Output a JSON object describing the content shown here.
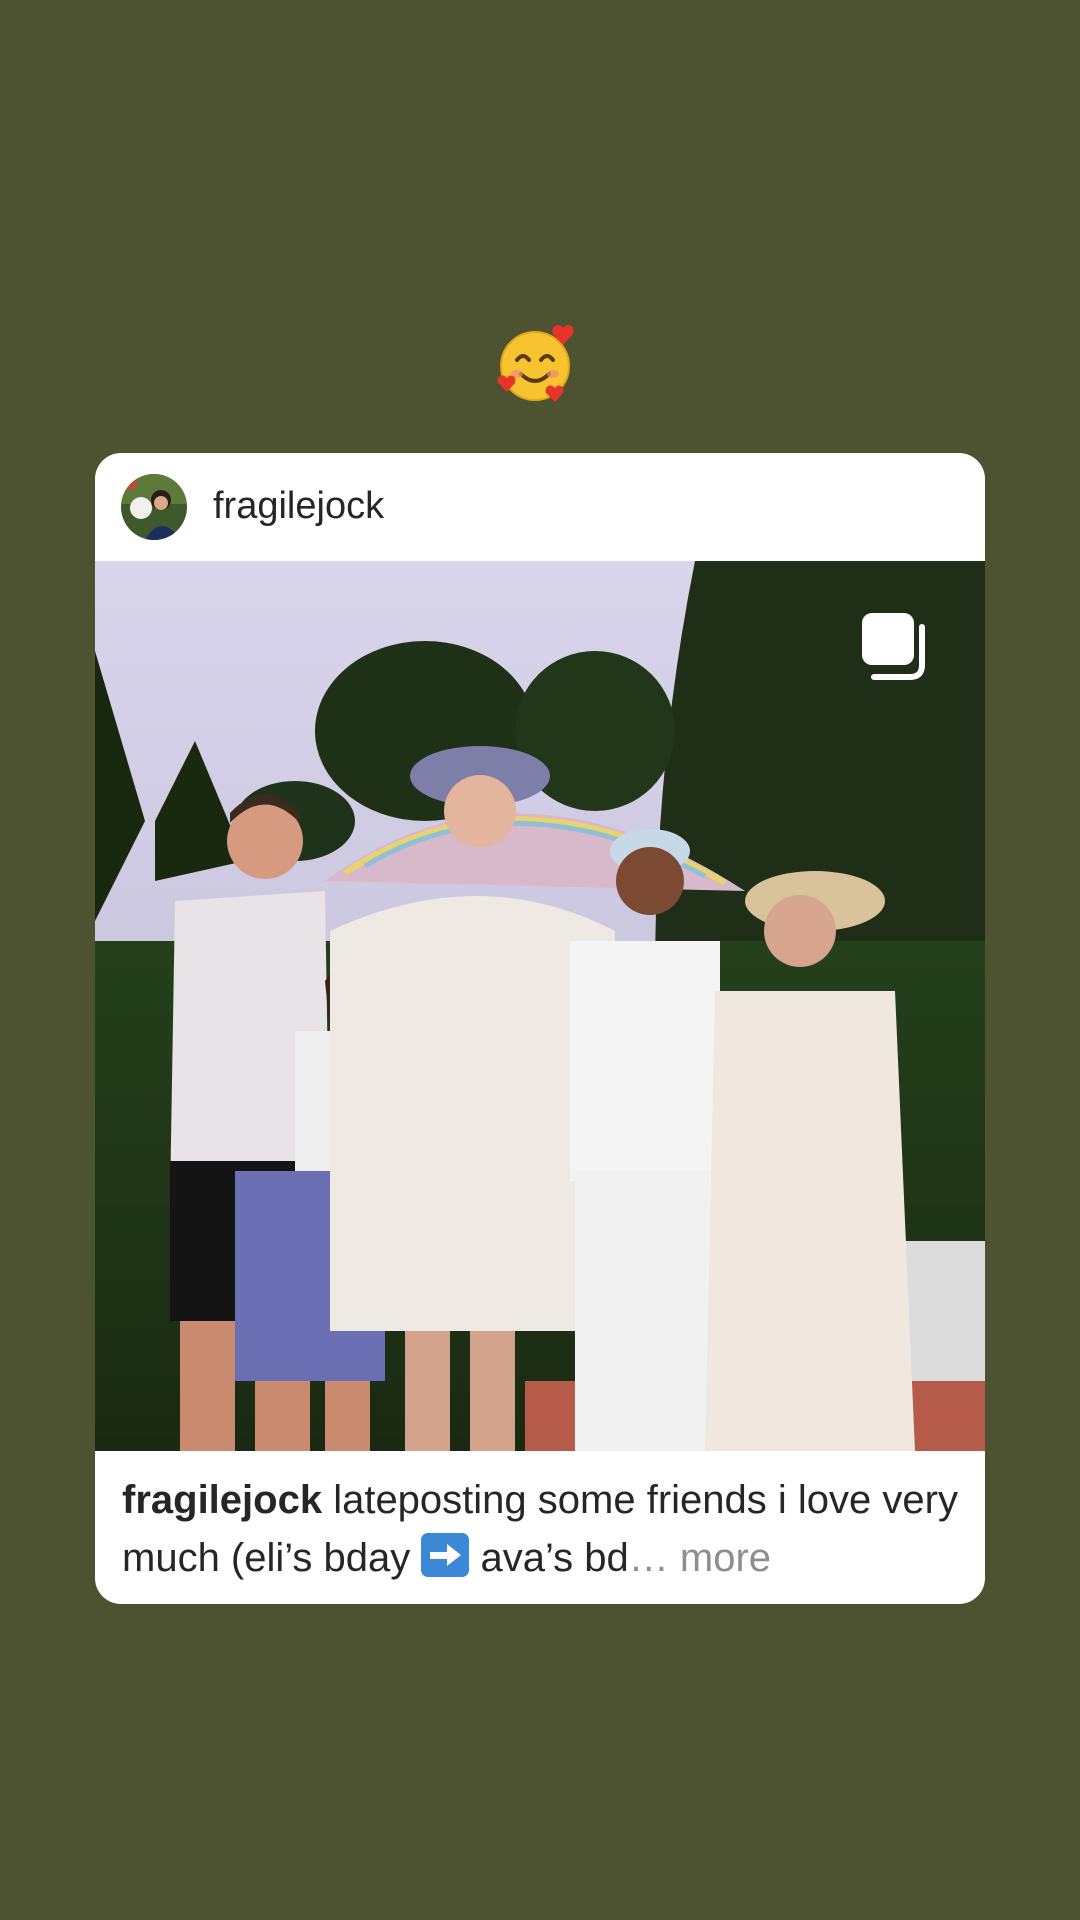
{
  "sticker": {
    "emoji": "smiling-face-with-hearts"
  },
  "post": {
    "username": "fragilejock",
    "avatar_icon": "profile-avatar",
    "carousel_icon": "carousel-multiple-icon",
    "caption": {
      "username": "fragilejock",
      "text_before_arrow": " lateposting some friends i love very much (eli’s bday ",
      "arrow": "➡️",
      "text_after_arrow": " ava’s bd",
      "more": "… more"
    }
  },
  "colors": {
    "background": "#4d5230",
    "card": "#ffffff",
    "text": "#262626",
    "muted": "#8e8e8e"
  }
}
